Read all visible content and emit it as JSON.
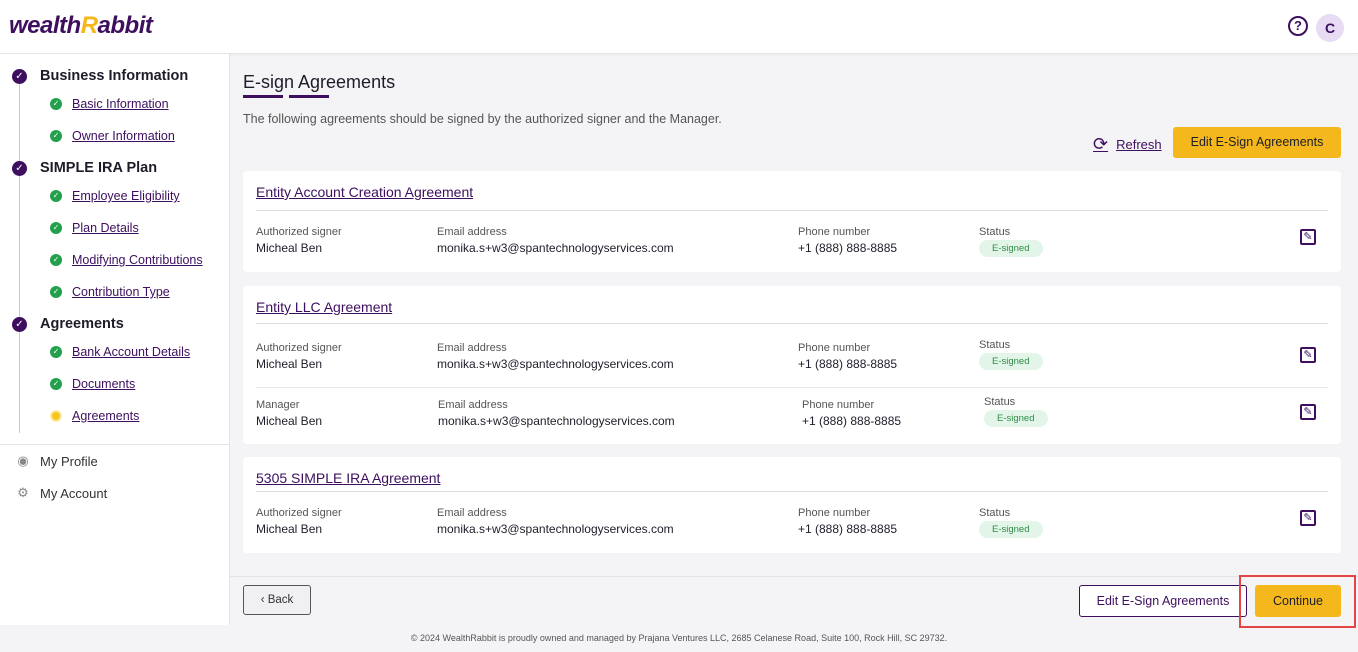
{
  "header": {
    "logo_text": "wealth",
    "logo_accent": "R",
    "logo_rest": "abbit",
    "help_icon": "?",
    "avatar_initial": "C"
  },
  "sidebar": {
    "sections": [
      {
        "label": "Business Information",
        "items": [
          "Basic Information",
          "Owner Information"
        ]
      },
      {
        "label": "SIMPLE IRA Plan",
        "items": [
          "Employee Eligibility",
          "Plan Details",
          "Modifying Contributions",
          "Contribution Type"
        ]
      },
      {
        "label": "Agreements",
        "items": [
          "Bank Account Details",
          "Documents",
          "Agreements"
        ]
      }
    ],
    "links": [
      "My Profile",
      "My Account"
    ]
  },
  "main": {
    "title": "E-sign Agreements",
    "subtitle": "The following agreements should be signed by the authorized signer and the Manager.",
    "refresh_label": "Refresh",
    "edit_top_label": "Edit E-Sign Agreements",
    "labels": {
      "email": "Email address",
      "phone": "Phone number",
      "status": "Status"
    },
    "cards": [
      {
        "title": "Entity Account Creation Agreement",
        "rows": [
          {
            "role": "Authorized signer",
            "name": "Micheal Ben",
            "email": "monika.s+w3@spantechnologyservices.com",
            "phone": "+1 (888) 888-8885",
            "status": "E-signed"
          }
        ]
      },
      {
        "title": "Entity LLC Agreement",
        "rows": [
          {
            "role": "Authorized signer",
            "name": "Micheal Ben",
            "email": "monika.s+w3@spantechnologyservices.com",
            "phone": "+1 (888) 888-8885",
            "status": "E-signed"
          },
          {
            "role": "Manager",
            "name": "Micheal Ben",
            "email": "monika.s+w3@spantechnologyservices.com",
            "phone": "+1 (888) 888-8885",
            "status": "E-signed"
          }
        ]
      },
      {
        "title": "5305 SIMPLE IRA Agreement",
        "rows": [
          {
            "role": "Authorized signer",
            "name": "Micheal Ben",
            "email": "monika.s+w3@spantechnologyservices.com",
            "phone": "+1 (888) 888-8885",
            "status": "E-signed"
          }
        ]
      }
    ]
  },
  "footer": {
    "back_label": "Back",
    "back_icon": "‹",
    "edit_label": "Edit E-Sign Agreements",
    "continue_label": "Continue",
    "copyright": "© 2024 WealthRabbit is proudly owned and managed by Prajana Ventures LLC, 2685 Celanese Road, Suite 100, Rock Hill, SC 29732."
  },
  "colors": {
    "brand_purple": "#3d0f5e",
    "brand_yellow": "#f5b81c",
    "success_green": "#22a04b"
  }
}
